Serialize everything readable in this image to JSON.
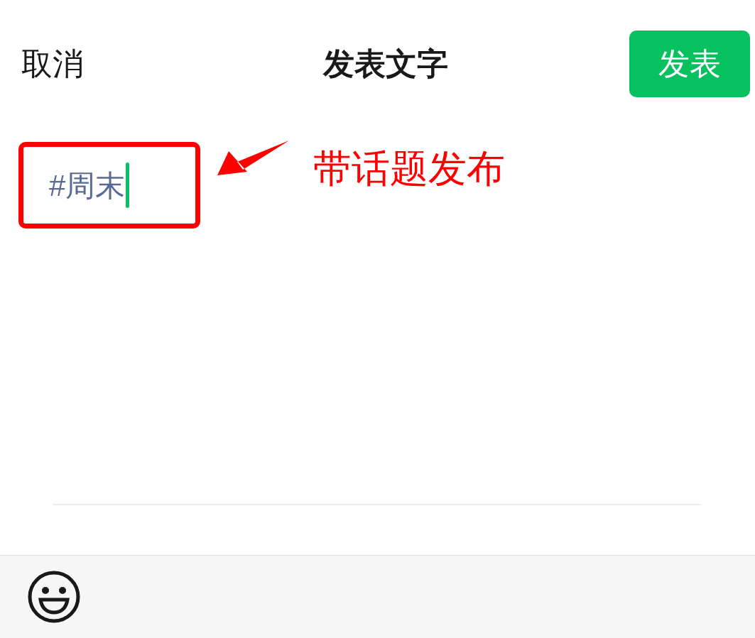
{
  "header": {
    "cancel": "取消",
    "title": "发表文字",
    "publish": "发表"
  },
  "editor": {
    "value": "#周末",
    "focused": true
  },
  "annotation": {
    "text": "带话题发布"
  },
  "toolbar": {
    "kind": "emoji"
  }
}
